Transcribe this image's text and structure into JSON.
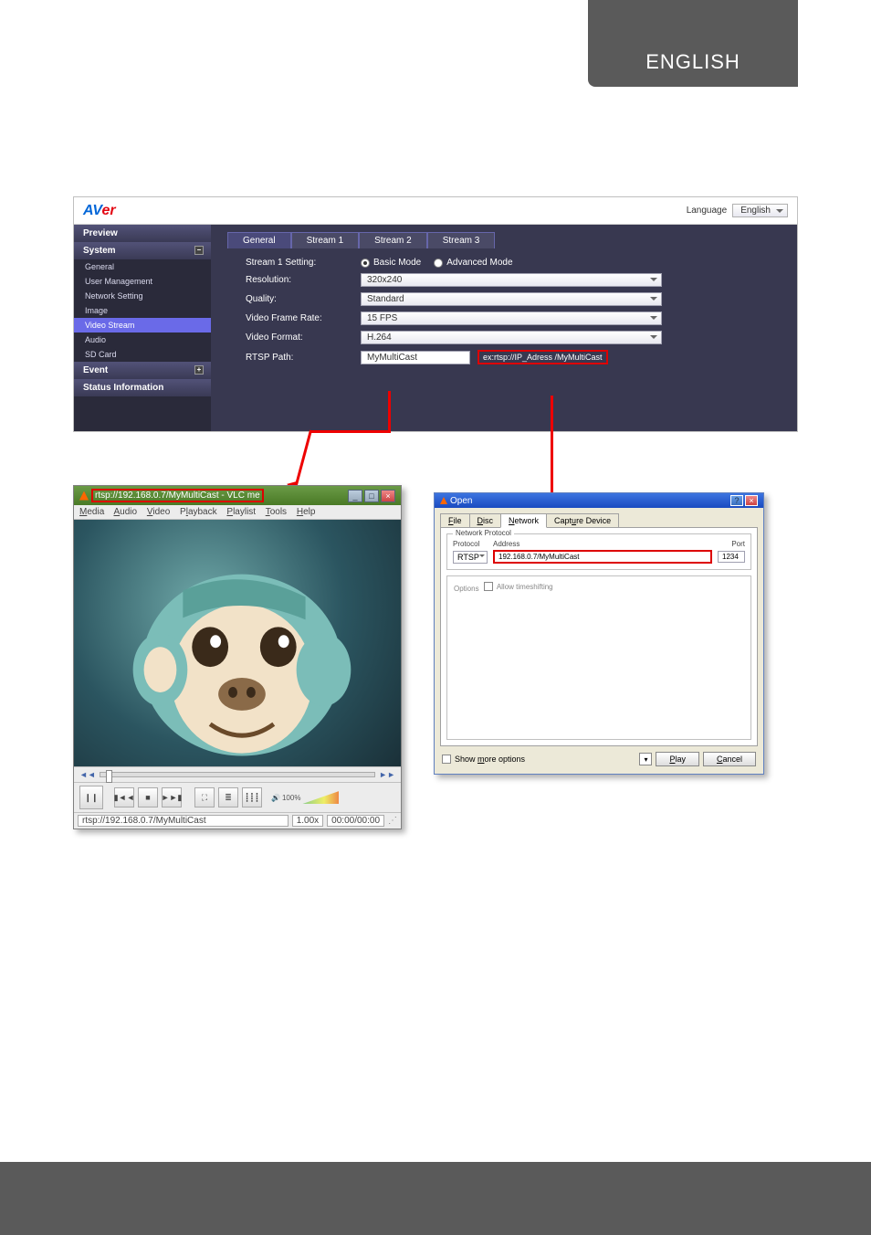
{
  "page": {
    "language_tab": "ENGLISH"
  },
  "admin": {
    "logo_a": "AV",
    "logo_r": "er",
    "language_label": "Language",
    "language_value": "English",
    "sidebar": {
      "preview": "Preview",
      "system": "System",
      "items": [
        "General",
        "User Management",
        "Network Setting",
        "Image",
        "Video Stream",
        "Audio",
        "SD Card"
      ],
      "event": "Event",
      "status": "Status Information"
    },
    "tabs": [
      "General",
      "Stream 1",
      "Stream 2",
      "Stream 3"
    ],
    "form": {
      "setting_label": "Stream 1 Setting:",
      "basic": "Basic Mode",
      "advanced": "Advanced Mode",
      "resolution_label": "Resolution:",
      "resolution": "320x240",
      "quality_label": "Quality:",
      "quality": "Standard",
      "fps_label": "Video Frame Rate:",
      "fps": "15 FPS",
      "format_label": "Video Format:",
      "format": "H.264",
      "rtsp_label": "RTSP Path:",
      "rtsp_value": "MyMultiCast",
      "rtsp_eg": "ex:rtsp://IP_Adress /MyMultiCast"
    }
  },
  "vlc": {
    "title": "rtsp://192.168.0.7/MyMultiCast - VLC me",
    "menu": [
      "Media",
      "Audio",
      "Video",
      "Playback",
      "Playlist",
      "Tools",
      "Help"
    ],
    "seek_prev": "◄◄",
    "seek_next": "►►",
    "vol_pct": "100%",
    "status_url": "rtsp://192.168.0.7/MyMultiCast",
    "status_speed": "1.00x",
    "status_time": "00:00/00:00"
  },
  "open": {
    "title": "Open",
    "tabs": {
      "file": "File",
      "disc": "Disc",
      "network": "Network",
      "capture": "Capture Device"
    },
    "fieldset_label": "Network Protocol",
    "proto_label": "Protocol",
    "addr_label": "Address",
    "port_label": "Port",
    "proto": "RTSP",
    "address": "192.168.0.7/MyMultiCast",
    "port": "1234",
    "options_label": "Options",
    "allow_ts": "Allow timeshifting",
    "show_more": "Show more options",
    "play": "Play",
    "cancel": "Cancel"
  }
}
